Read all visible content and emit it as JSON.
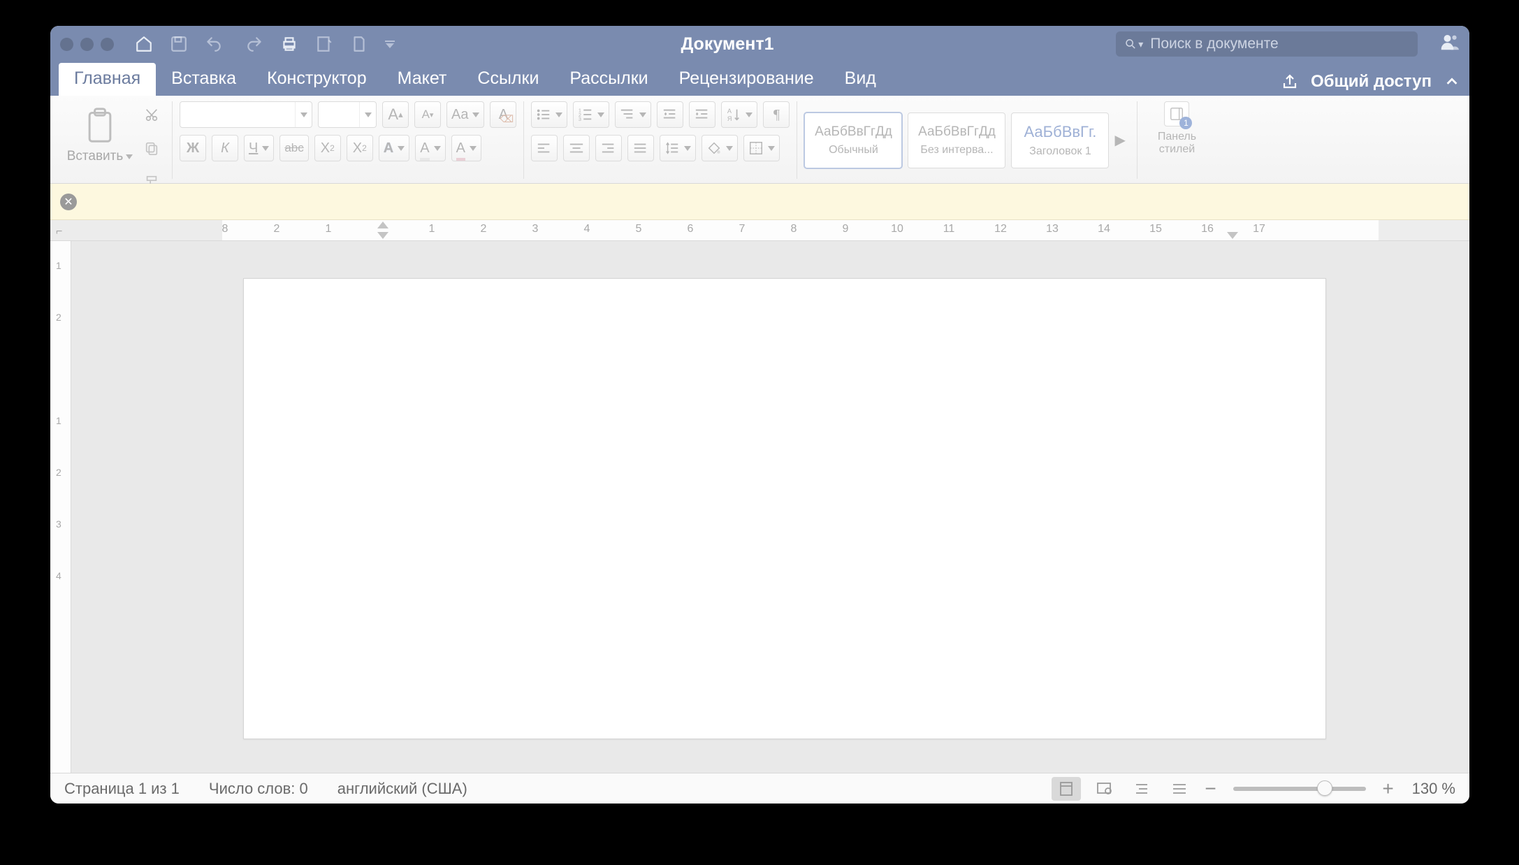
{
  "title": "Документ1",
  "search_placeholder": "Поиск в документе",
  "share_label": "Общий доступ",
  "tabs": {
    "t0": "Главная",
    "t1": "Вставка",
    "t2": "Конструктор",
    "t3": "Макет",
    "t4": "Ссылки",
    "t5": "Рассылки",
    "t6": "Рецензирование",
    "t7": "Вид"
  },
  "ribbon": {
    "paste_label": "Вставить",
    "bold": "Ж",
    "italic": "К",
    "underline": "Ч",
    "strike": "abc",
    "subscript": "X₂",
    "superscript": "X²",
    "grow": "A",
    "shrink": "A",
    "case": "Aa",
    "clear": "A",
    "fontcolor": "A",
    "highlight": "A",
    "styles": {
      "s0_sample": "АаБбВвГгДд",
      "s0_name": "Обычный",
      "s1_sample": "АаБбВвГгДд",
      "s1_name": "Без интерва...",
      "s2_sample": "АаБбВвГг.",
      "s2_name": "Заголовок 1"
    },
    "styles_pane": "Панель\nстилей"
  },
  "ruler_h": [
    "8",
    "2",
    "1",
    "1",
    "2",
    "3",
    "4",
    "5",
    "6",
    "7",
    "8",
    "9",
    "10",
    "11",
    "12",
    "13",
    "14",
    "15",
    "16",
    "17"
  ],
  "ruler_v": [
    "1",
    "2",
    "1",
    "2",
    "3",
    "4"
  ],
  "status": {
    "page": "Страница 1 из 1",
    "words": "Число слов: 0",
    "lang": "английский (США)",
    "zoom": "130 %"
  }
}
